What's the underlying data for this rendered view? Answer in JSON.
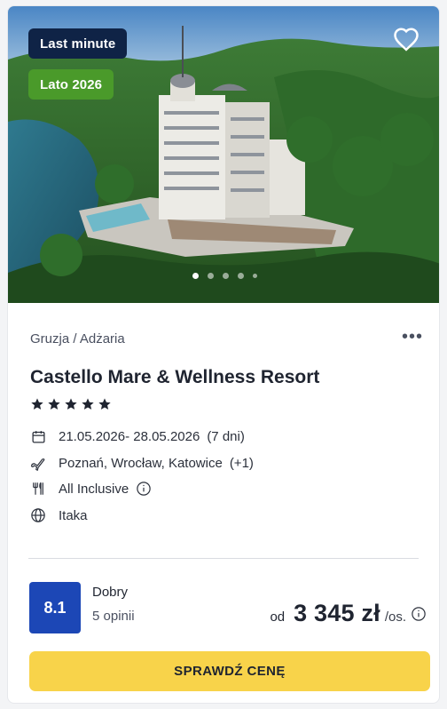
{
  "hero": {
    "badges": {
      "last_minute": "Last minute",
      "season": "Lato 2026"
    },
    "carousel": {
      "count": 5,
      "active_index": 0
    },
    "favorite_icon": "heart-outline-icon"
  },
  "offer": {
    "location": "Gruzja / Adżaria",
    "more_label": "•••",
    "title": "Castello Mare & Wellness Resort",
    "stars": 5,
    "dates": "21.05.2026- 28.05.2026",
    "duration": "(7 dni)",
    "airports": "Poznań, Wrocław, Katowice",
    "airports_more": "(+1)",
    "board": "All Inclusive",
    "operator": "Itaka"
  },
  "rating": {
    "score": "8.1",
    "label": "Dobry",
    "count": "5 opinii"
  },
  "price": {
    "prefix": "od",
    "amount": "3 345 zł",
    "unit": "/os."
  },
  "cta": {
    "label": "SPRAWDŹ CENĘ"
  },
  "colors": {
    "badge_last_minute": "#0f2346",
    "badge_season": "#4a9a2a",
    "rating_box": "#1c47b6",
    "cta": "#f8d34a"
  },
  "icons": [
    "calendar-icon",
    "plane-icon",
    "cutlery-icon",
    "info-icon",
    "globe-icon",
    "star-icon",
    "heart-outline-icon"
  ]
}
